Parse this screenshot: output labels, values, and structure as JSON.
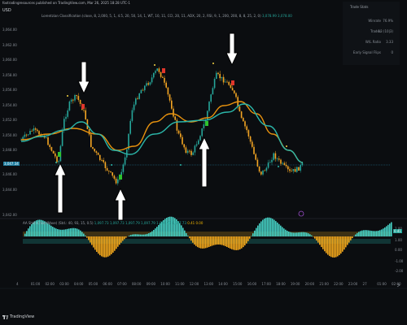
{
  "header": {
    "published_line": "foxtradingresources published on TradingView.com, Mar 26, 2025 18:28 UTC-1",
    "symbol": "USD",
    "indicator_name": "Lorentzian Classification (close, 8, 2,000, 5, 1, 4.5, 20, 50, 14, 1, WT, 10, 11, CCI, 20, 11, ADX, 20, 2, RSI, 9, 1, 200, 200, 8, 8, 25, 2, 0)",
    "indicator_value": "3,078.99 3,078.00"
  },
  "stats": {
    "title": "Trade Stats",
    "rows": [
      {
        "label": "Winrate",
        "value": "76.9%"
      },
      {
        "label": "Trades",
        "value": "13 (10|3)"
      },
      {
        "label": "W/L Ratio",
        "value": "3.33"
      },
      {
        "label": "Early Signal Flips",
        "value": "0"
      }
    ]
  },
  "price_axis": {
    "ticks": [
      "3,064.00",
      "3,062.00",
      "3,060.00",
      "3,058.00",
      "3,056.00",
      "3,054.00",
      "3,052.00",
      "3,050.00",
      "3,048.00",
      "3,046.00",
      "3,044.00",
      "3,042.00"
    ],
    "current_price_tag": "3,047.34"
  },
  "oscillator": {
    "legend_name": "AA Shift (ChartWave) (Std.: 40, 93, 15, 0.5)",
    "legend_teal_values": "1,097.73 1,097.73 1,097.79 1,097.79 1,097.76 1,097.73",
    "legend_yellow_values": "0.41 0.00",
    "right_ticks": [
      "2.00",
      "1.00",
      "0.00",
      "-1.00",
      "-2.00"
    ],
    "value_tag": "0.41"
  },
  "x_axis": {
    "ticks": [
      "4",
      "01:00",
      "02:00",
      "03:00",
      "04:00",
      "05:00",
      "06:00",
      "07:00",
      "08:00",
      "09:00",
      "10:00",
      "11:00",
      "12:00",
      "13:00",
      "14:00",
      "15:00",
      "16:00",
      "17:00",
      "18:00",
      "19:00",
      "20:00",
      "21:00",
      "22:00",
      "23:00",
      "27",
      "01:00",
      "02:00"
    ]
  },
  "footer": {
    "brand": "TradingView"
  },
  "colors": {
    "background": "#0b0d10",
    "bull_candle": "#26a69a",
    "bear_candle": "#f5a623",
    "slow_ma": "#e8920e",
    "fast_ma": "#2bb5a8",
    "osc_positive": "#45d0c4",
    "osc_negative": "#f2a71b",
    "buy_marker": "#2ec22e",
    "sell_marker": "#e0362b"
  }
}
